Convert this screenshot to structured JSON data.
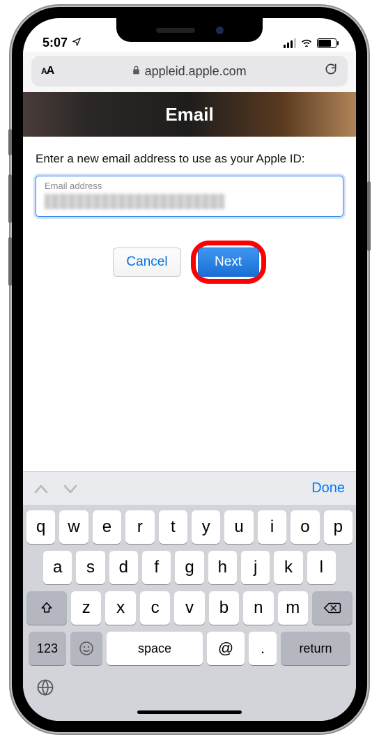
{
  "status": {
    "time": "5:07",
    "location_icon": "◤"
  },
  "browser": {
    "text_size_label": "AA",
    "lock_icon": "lock",
    "domain": "appleid.apple.com",
    "refresh_icon": "↻"
  },
  "page": {
    "banner_title": "Email",
    "instruction": "Enter a new email address to use as your Apple ID:",
    "email_label": "Email address",
    "cancel_label": "Cancel",
    "next_label": "Next"
  },
  "keyboard": {
    "done_label": "Done",
    "row1": [
      "q",
      "w",
      "e",
      "r",
      "t",
      "y",
      "u",
      "i",
      "o",
      "p"
    ],
    "row2": [
      "a",
      "s",
      "d",
      "f",
      "g",
      "h",
      "j",
      "k",
      "l"
    ],
    "row3": [
      "z",
      "x",
      "c",
      "v",
      "b",
      "n",
      "m"
    ],
    "shift_icon": "⇧",
    "backspace_icon": "⌫",
    "numbers_label": "123",
    "emoji_icon": "☺",
    "space_label": "space",
    "at_label": "@",
    "dot_label": ".",
    "return_label": "return",
    "globe_icon": "🌐"
  }
}
